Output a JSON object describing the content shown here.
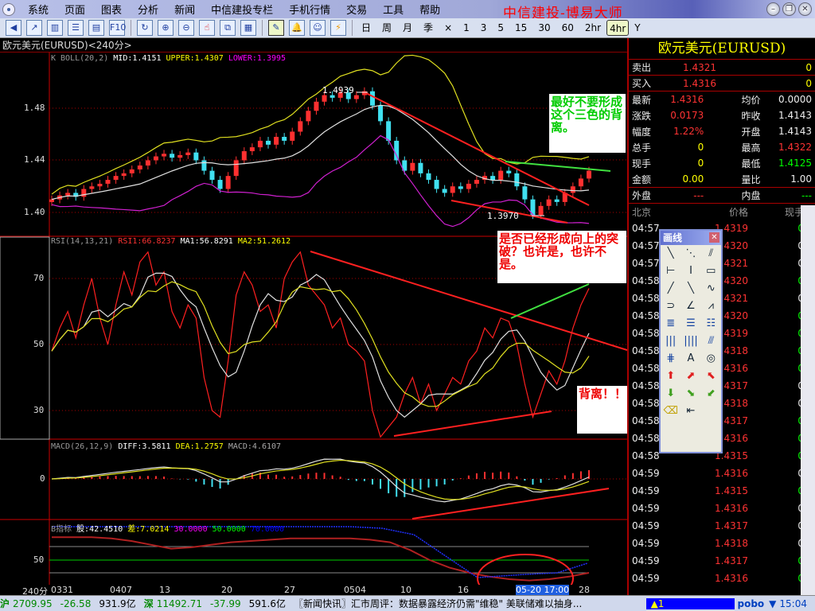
{
  "app_title": "中信建投-博易大师",
  "menu": [
    "系统",
    "页面",
    "图表",
    "分析",
    "新闻",
    "中信建投专栏",
    "手机行情",
    "交易",
    "工具",
    "帮助"
  ],
  "toolbar": {
    "icons": [
      "back-icon",
      "line-chart-icon",
      "kline-icon",
      "list-icon",
      "report-icon",
      "f10-icon",
      "refresh-icon",
      "zoom-in-icon",
      "zoom-out-icon",
      "pointer-icon",
      "window-icon",
      "panel-icon",
      "draw-icon",
      "alarm-icon",
      "users-icon",
      "flash-icon"
    ],
    "f10_label": "F10",
    "periods": [
      "日",
      "周",
      "月",
      "季",
      "×",
      "1",
      "3",
      "5",
      "15",
      "30",
      "60",
      "2hr",
      "4hr",
      "Y"
    ],
    "active_period": "4hr"
  },
  "chart": {
    "title": "欧元美元(EURUSD)<240分>",
    "boll": {
      "name": "K  BOLL(20,2)",
      "mid": "MID:1.4151",
      "upper": "UPPER:1.4307",
      "lower": "LOWER:1.3995"
    },
    "rsi": {
      "name": "RSI(14,13,21)",
      "rsi1": "RSI1:66.8237",
      "ma1": "MA1:56.8291",
      "ma2": "MA2:51.2612"
    },
    "macd": {
      "name": "MACD(26,12,9)",
      "diff": "DIFF:3.5811",
      "dea": "DEA:1.2757",
      "macd": "MACD:4.6107"
    },
    "bind": {
      "name": "B指标",
      "gu": "股:42.4510",
      "cha": "差:7.0214",
      "l30": "30.0000",
      "l50": "50.0000",
      "l70": "70.0000"
    },
    "k_yticks": [
      "1.48",
      "1.44",
      "1.40"
    ],
    "rsi_yticks": [
      "70",
      "50",
      "30"
    ],
    "macd_ytick": "0",
    "b_ytick": "50",
    "high_label": "1.4939",
    "low_label": "1.3970",
    "period_label": "240分",
    "xticks": [
      "0331",
      "0407",
      "13",
      "20",
      "27",
      "0504",
      "10",
      "16",
      "05-20 17:00",
      "28"
    ],
    "colors": {
      "up": "#ff3030",
      "down": "#40e0f0",
      "upper": "#e0e020",
      "lower": "#d020d0",
      "mid": "#e0e0e0",
      "trend": "#ff2020",
      "trend_up": "#40e040"
    },
    "closes": [
      1.41,
      1.413,
      1.415,
      1.412,
      1.418,
      1.42,
      1.422,
      1.425,
      1.428,
      1.43,
      1.433,
      1.436,
      1.44,
      1.443,
      1.445,
      1.442,
      1.444,
      1.446,
      1.44,
      1.432,
      1.425,
      1.418,
      1.428,
      1.44,
      1.447,
      1.45,
      1.455,
      1.452,
      1.458,
      1.455,
      1.462,
      1.47,
      1.478,
      1.485,
      1.49,
      1.488,
      1.492,
      1.487,
      1.49,
      1.493,
      1.482,
      1.47,
      1.455,
      1.44,
      1.432,
      1.438,
      1.43,
      1.425,
      1.418,
      1.415,
      1.42,
      1.418,
      1.422,
      1.425,
      1.428,
      1.425,
      1.432,
      1.43,
      1.42,
      1.41,
      1.398,
      1.405,
      1.41,
      1.408,
      1.415,
      1.42,
      1.426,
      1.432
    ],
    "rsi_values": [
      48,
      55,
      60,
      52,
      62,
      70,
      58,
      50,
      62,
      72,
      65,
      75,
      78,
      68,
      72,
      60,
      55,
      62,
      58,
      40,
      30,
      28,
      45,
      65,
      72,
      68,
      60,
      62,
      55,
      70,
      75,
      78,
      68,
      65,
      62,
      55,
      58,
      50,
      48,
      45,
      30,
      22,
      25,
      28,
      35,
      40,
      32,
      38,
      30,
      35,
      40,
      38,
      45,
      48,
      55,
      52,
      58,
      57,
      50,
      38,
      28,
      35,
      42,
      38,
      45,
      55,
      62,
      67
    ],
    "b_values": [
      68,
      68,
      68,
      67,
      65,
      62,
      59,
      60,
      62,
      64,
      65,
      66,
      67,
      67,
      67,
      67,
      66,
      64,
      58,
      50,
      44,
      40,
      37,
      35,
      34,
      35,
      37,
      40
    ]
  },
  "notes": {
    "n1": "最好不要形成这个三色的背离。",
    "n2": "是否已经形成向上的突破？也许是，也许不是。",
    "n3": "背离！！"
  },
  "quote": {
    "title": "欧元美元(EURUSD)",
    "sell": {
      "label": "卖出",
      "price": "1.4321",
      "vol": "0"
    },
    "buy": {
      "label": "买入",
      "price": "1.4316",
      "vol": "0"
    },
    "rows": [
      {
        "l1": "最新",
        "v1": "1.4316",
        "l2": "均价",
        "v2": "0.0000",
        "c1": "red",
        "c2": "wht"
      },
      {
        "l1": "涨跌",
        "v1": "0.0173",
        "l2": "昨收",
        "v2": "1.4143",
        "c1": "red",
        "c2": "wht"
      },
      {
        "l1": "幅度",
        "v1": "1.22%",
        "l2": "开盘",
        "v2": "1.4143",
        "c1": "red",
        "c2": "wht"
      },
      {
        "l1": "总手",
        "v1": "0",
        "l2": "最高",
        "v2": "1.4322",
        "c1": "yel",
        "c2": "red"
      },
      {
        "l1": "现手",
        "v1": "0",
        "l2": "最低",
        "v2": "1.4125",
        "c1": "yel",
        "c2": "grn"
      },
      {
        "l1": "金额",
        "v1": "0.00",
        "l2": "量比",
        "v2": "1.00",
        "c1": "yel",
        "c2": "wht"
      }
    ],
    "outer": {
      "l1": "外盘",
      "v1": "---",
      "l2": "内盘",
      "v2": "---"
    },
    "tick_header": [
      "北京",
      "价格",
      "现手"
    ],
    "ticks": [
      [
        "04:57",
        "1.4319",
        "0",
        "grn"
      ],
      [
        "04:57",
        "1.4320",
        "0",
        "wht"
      ],
      [
        "04:57",
        "1.4321",
        "0",
        "wht"
      ],
      [
        "04:58",
        "1.4320",
        "0",
        "grn"
      ],
      [
        "04:58",
        "1.4321",
        "0",
        "wht"
      ],
      [
        "04:58",
        "1.4320",
        "0",
        "grn"
      ],
      [
        "04:58",
        "1.4319",
        "0",
        "grn"
      ],
      [
        "04:58",
        "1.4318",
        "0",
        "grn"
      ],
      [
        "04:58",
        "1.4316",
        "0",
        "grn"
      ],
      [
        "04:58",
        "1.4317",
        "0",
        "wht"
      ],
      [
        "04:58",
        "1.4318",
        "0",
        "wht"
      ],
      [
        "04:58",
        "1.4317",
        "0",
        "grn"
      ],
      [
        "04:58",
        "1.4316",
        "0",
        "grn"
      ],
      [
        "04:58",
        "1.4315",
        "0",
        "grn"
      ],
      [
        "04:59",
        "1.4316",
        "0",
        "wht"
      ],
      [
        "04:59",
        "1.4315",
        "0",
        "grn"
      ],
      [
        "04:59",
        "1.4316",
        "0",
        "wht"
      ],
      [
        "04:59",
        "1.4317",
        "0",
        "wht"
      ],
      [
        "04:59",
        "1.4318",
        "0",
        "wht"
      ],
      [
        "04:59",
        "1.4317",
        "0",
        "grn"
      ],
      [
        "04:59",
        "1.4316",
        "0",
        "grn"
      ]
    ]
  },
  "toolbox": {
    "title": "画线",
    "tools": [
      {
        "g": "╲",
        "n": "line-icon"
      },
      {
        "g": "⋱",
        "n": "segment-icon"
      },
      {
        "g": "⫽",
        "n": "parallel-icon"
      },
      {
        "g": "⊢",
        "n": "horizontal-line-icon"
      },
      {
        "g": "I",
        "n": "vertical-line-icon"
      },
      {
        "g": "▭",
        "n": "rectangle-icon"
      },
      {
        "g": "╱",
        "n": "ray-up-icon"
      },
      {
        "g": "╲",
        "n": "ray-down-icon"
      },
      {
        "g": "∿",
        "n": "wave-icon"
      },
      {
        "g": "⊃",
        "n": "arc-icon"
      },
      {
        "g": "∠",
        "n": "angle-icon"
      },
      {
        "g": "⩘",
        "n": "fan-icon"
      },
      {
        "g": "≣",
        "n": "fibonacci-icon"
      },
      {
        "g": "☰",
        "n": "percent-lines-icon"
      },
      {
        "g": "☷",
        "n": "golden-lines-icon"
      },
      {
        "g": "|||",
        "n": "cycle-lines-icon"
      },
      {
        "g": "||||",
        "n": "fib-cycle-icon"
      },
      {
        "g": "⫻",
        "n": "gann-icon"
      },
      {
        "g": "⋕",
        "n": "channel-icon"
      },
      {
        "g": "A",
        "n": "text-icon"
      },
      {
        "g": "◎",
        "n": "circle-icon"
      },
      {
        "g": "⬆",
        "n": "arrow-up-icon"
      },
      {
        "g": "⬈",
        "n": "arrow-upright-icon"
      },
      {
        "g": "⬉",
        "n": "arrow-upleft-icon"
      },
      {
        "g": "⬇",
        "n": "arrow-down-icon"
      },
      {
        "g": "⬊",
        "n": "arrow-downright-icon"
      },
      {
        "g": "⬋",
        "n": "arrow-downleft-icon"
      },
      {
        "g": "⌫",
        "n": "eraser-icon"
      },
      {
        "g": "⇤",
        "n": "delete-all-icon"
      }
    ]
  },
  "status": {
    "sh_label": "沪",
    "sh_index": "2709.95",
    "sh_chg": "-26.58",
    "sh_amt": "931.9亿",
    "sz_label": "深",
    "sz_index": "11492.71",
    "sz_chg": "-37.99",
    "sz_amt": "591.6亿",
    "news": "〖新闻快讯〗汇市周评：数据暴露经济仍需\"维稳\" 美联储难以抽身...",
    "alert": "▲1",
    "brand": "pobo",
    "time": "15:04"
  }
}
